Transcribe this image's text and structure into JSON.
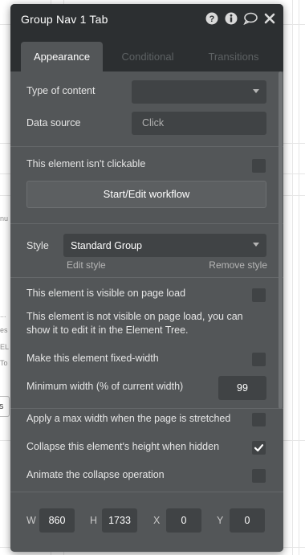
{
  "panel": {
    "title": "Group Nav 1 Tab",
    "icons": [
      "question-circle-icon",
      "info-circle-icon",
      "comment-icon",
      "close-icon"
    ]
  },
  "tabs": [
    {
      "label": "Appearance",
      "active": true
    },
    {
      "label": "Conditional",
      "active": false
    },
    {
      "label": "Transitions",
      "active": false
    }
  ],
  "fields": {
    "type_of_content_label": "Type of content",
    "type_of_content_value": "",
    "data_source_label": "Data source",
    "data_source_placeholder": "Click",
    "not_clickable_label": "This element isn't clickable",
    "not_clickable_checked": false,
    "workflow_button": "Start/Edit workflow",
    "style_label": "Style",
    "style_value": "Standard Group",
    "edit_style": "Edit style",
    "remove_style": "Remove style",
    "visible_on_load_label": "This element is visible on page load",
    "visible_on_load_checked": false,
    "visible_on_load_note": "This element is not visible on page load, you can show it to edit it in the Element Tree.",
    "fixed_width_label": "Make this element fixed-width",
    "fixed_width_checked": false,
    "min_width_label": "Minimum width (% of current width)",
    "min_width_value": "99",
    "max_width_label": "Apply a max width when the page is stretched",
    "max_width_checked": false,
    "collapse_label": "Collapse this element's height when hidden",
    "collapse_checked": true,
    "animate_collapse_label": "Animate the collapse operation",
    "animate_collapse_checked": false
  },
  "dimensions": {
    "w_label": "W",
    "w_value": "860",
    "h_label": "H",
    "h_value": "1733",
    "x_label": "X",
    "x_value": "0",
    "y_label": "Y",
    "y_value": "0"
  },
  "background": {
    "fragments": [
      "nu",
      "...",
      "es",
      "EL",
      "To",
      "ts"
    ]
  },
  "colors": {
    "panel_bg": "#535658",
    "header_bg": "#2c2f31",
    "input_bg": "#404345",
    "text": "#e6e6e6"
  }
}
